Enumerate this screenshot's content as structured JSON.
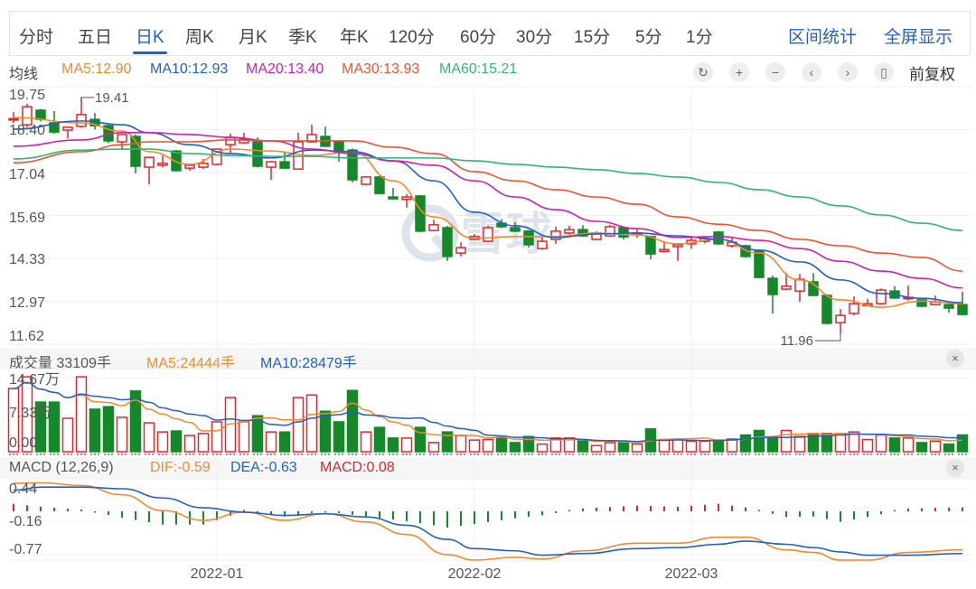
{
  "tabs": [
    "分时",
    "五日",
    "日K",
    "周K",
    "月K",
    "季K",
    "年K",
    "120分",
    "60分",
    "30分",
    "15分",
    "5分",
    "1分"
  ],
  "active_tab": "日K",
  "actions": {
    "range_stats": "区间统计",
    "fullscreen": "全屏显示"
  },
  "ma_row": {
    "title": "均线",
    "ma5": "MA5:12.90",
    "ma10": "MA10:12.93",
    "ma20": "MA20:13.40",
    "ma30": "MA30:13.93",
    "ma60": "MA60:15.21",
    "adjust": "前复权",
    "controls": [
      "reset-icon",
      "zoom-in-icon",
      "zoom-out-icon",
      "chevron-left-icon",
      "chevron-right-icon",
      "candle-style-icon"
    ]
  },
  "volume_head": {
    "title": "成交量 33109手",
    "ma5": "MA5:24444手",
    "ma10": "MA10:28479手",
    "close": "×"
  },
  "macd_head": {
    "title": "MACD (12,26,9)",
    "dif": "DIF:-0.59",
    "dea": "DEA:-0.63",
    "macd": "MACD:0.08",
    "close": "×"
  },
  "watermark": "雪球",
  "colors": {
    "up": "#e3262b",
    "down": "#15892a",
    "ma5": "#f5892a",
    "ma10": "#2360c4",
    "ma20": "#d01db5",
    "ma30": "#f4512c",
    "ma60": "#2fb874",
    "accent": "#1f5fcc"
  },
  "chart_data": [
    {
      "type": "candlestick",
      "title": "日K",
      "ylim": [
        11.62,
        19.75
      ],
      "y_ticks": [
        "19.75",
        "18.40",
        "17.04",
        "15.69",
        "14.33",
        "12.97",
        "11.62"
      ],
      "x_ticks": [
        {
          "label": "2022-01",
          "index": 15
        },
        {
          "label": "2022-02",
          "index": 34
        },
        {
          "label": "2022-03",
          "index": 50
        }
      ],
      "annotations": [
        {
          "label": "19.41",
          "index": 5,
          "kind": "high"
        },
        {
          "label": "11.96",
          "index": 61,
          "kind": "low"
        }
      ],
      "ohlc": [
        [
          18.7,
          18.95,
          18.6,
          18.74
        ],
        [
          18.55,
          19.21,
          18.47,
          19.12
        ],
        [
          19.01,
          19.05,
          18.65,
          18.72
        ],
        [
          18.61,
          18.98,
          18.27,
          18.32
        ],
        [
          18.38,
          18.5,
          18.12,
          18.47
        ],
        [
          18.5,
          19.41,
          18.45,
          18.87
        ],
        [
          18.72,
          18.92,
          18.4,
          18.52
        ],
        [
          18.52,
          18.58,
          17.97,
          18.04
        ],
        [
          18.01,
          18.26,
          17.75,
          18.24
        ],
        [
          18.18,
          18.24,
          17.01,
          17.24
        ],
        [
          17.21,
          17.52,
          16.67,
          17.52
        ],
        [
          17.27,
          17.58,
          17.2,
          17.33
        ],
        [
          17.72,
          17.75,
          17.07,
          17.1
        ],
        [
          17.18,
          17.3,
          17.1,
          17.27
        ],
        [
          17.21,
          17.47,
          17.15,
          17.33
        ],
        [
          17.3,
          17.8,
          17.27,
          17.78
        ],
        [
          17.92,
          18.27,
          17.64,
          18.15
        ],
        [
          17.98,
          18.3,
          17.95,
          18.1
        ],
        [
          18.01,
          18.15,
          17.2,
          17.24
        ],
        [
          17.21,
          17.4,
          16.81,
          17.38
        ],
        [
          17.38,
          17.69,
          17.15,
          17.18
        ],
        [
          17.15,
          18.3,
          17.15,
          18.01
        ],
        [
          18.01,
          18.55,
          17.98,
          18.24
        ],
        [
          18.18,
          18.49,
          17.85,
          17.87
        ],
        [
          18.01,
          18.04,
          17.38,
          17.72
        ],
        [
          17.75,
          17.8,
          16.73,
          16.81
        ],
        [
          16.67,
          16.93,
          16.64,
          16.9
        ],
        [
          16.9,
          16.93,
          16.35,
          16.38
        ],
        [
          16.27,
          16.56,
          16.19,
          16.21
        ],
        [
          16.19,
          16.36,
          15.93,
          16.27
        ],
        [
          16.3,
          16.33,
          15.16,
          15.19
        ],
        [
          15.21,
          15.55,
          15.18,
          15.39
        ],
        [
          15.3,
          15.36,
          14.25,
          14.39
        ],
        [
          14.5,
          14.84,
          14.39,
          14.67
        ],
        [
          14.93,
          15.1,
          14.9,
          15.02
        ],
        [
          14.87,
          15.36,
          14.84,
          15.3
        ],
        [
          15.44,
          15.56,
          15.3,
          15.33
        ],
        [
          15.3,
          15.47,
          15.16,
          15.19
        ],
        [
          15.19,
          15.22,
          14.67,
          14.76
        ],
        [
          14.64,
          14.99,
          14.6,
          14.87
        ],
        [
          14.93,
          15.33,
          14.79,
          15.19
        ],
        [
          15.13,
          15.36,
          15.08,
          15.24
        ],
        [
          15.24,
          15.38,
          15.0,
          15.04
        ],
        [
          14.93,
          15.19,
          14.9,
          15.13
        ],
        [
          15.04,
          15.39,
          15.0,
          15.33
        ],
        [
          15.3,
          15.33,
          14.93,
          15.01
        ],
        [
          15.1,
          15.25,
          14.98,
          15.13
        ],
        [
          15.02,
          15.05,
          14.3,
          14.47
        ],
        [
          14.55,
          14.84,
          14.52,
          14.61
        ],
        [
          14.7,
          14.79,
          14.25,
          14.76
        ],
        [
          14.79,
          14.99,
          14.64,
          14.9
        ],
        [
          14.87,
          15.04,
          14.8,
          14.96
        ],
        [
          15.16,
          15.2,
          14.76,
          14.79
        ],
        [
          14.73,
          15.02,
          14.67,
          14.84
        ],
        [
          14.73,
          14.76,
          14.36,
          14.39
        ],
        [
          14.56,
          14.6,
          13.7,
          13.73
        ],
        [
          13.7,
          13.79,
          12.59,
          13.19
        ],
        [
          13.36,
          13.87,
          13.33,
          13.45
        ],
        [
          13.3,
          13.84,
          12.96,
          13.67
        ],
        [
          13.59,
          13.87,
          13.13,
          13.16
        ],
        [
          13.16,
          13.2,
          12.25,
          12.28
        ],
        [
          12.3,
          12.73,
          11.96,
          12.53
        ],
        [
          12.59,
          13.13,
          12.53,
          12.9
        ],
        [
          12.84,
          13.05,
          12.82,
          12.9
        ],
        [
          12.9,
          13.38,
          12.87,
          13.33
        ],
        [
          13.3,
          13.45,
          13.05,
          13.08
        ],
        [
          13.07,
          13.47,
          13.0,
          13.1
        ],
        [
          13.02,
          13.05,
          12.79,
          12.82
        ],
        [
          12.87,
          13.16,
          12.84,
          12.96
        ],
        [
          12.87,
          12.9,
          12.62,
          12.76
        ],
        [
          12.87,
          13.28,
          12.53,
          12.56
        ]
      ],
      "ma_index": [
        0,
        5,
        8,
        10,
        13,
        16,
        19,
        22,
        25,
        28,
        31,
        34,
        37,
        40,
        43,
        46,
        49,
        52,
        55,
        58,
        61,
        64,
        67,
        70
      ],
      "series": [
        {
          "name": "MA5",
          "values": [
            18.78,
            18.61,
            18.35,
            17.7,
            17.3,
            17.78,
            17.72,
            17.58,
            17.7,
            16.78,
            15.64,
            14.96,
            15.02,
            15.02,
            15.13,
            15.07,
            14.79,
            14.93,
            14.5,
            13.65,
            13.02,
            12.79,
            12.98,
            12.9
          ]
        },
        {
          "name": "MA10",
          "values": [
            18.41,
            18.67,
            18.55,
            18.3,
            17.92,
            17.64,
            17.5,
            17.75,
            17.7,
            17.41,
            16.78,
            15.79,
            15.36,
            14.99,
            15.1,
            15.13,
            15.04,
            14.93,
            14.59,
            14.22,
            13.65,
            13.22,
            13.07,
            12.93
          ]
        },
        {
          "name": "MA20",
          "values": [
            17.87,
            18.07,
            18.3,
            18.3,
            18.24,
            18.15,
            18.04,
            17.78,
            17.64,
            17.41,
            17.27,
            16.78,
            16.27,
            15.87,
            15.5,
            15.27,
            14.99,
            15.02,
            14.9,
            14.64,
            14.24,
            13.93,
            13.7,
            13.4
          ]
        },
        {
          "name": "MA30",
          "values": [
            17.35,
            17.7,
            17.92,
            18.01,
            18.01,
            18.07,
            18.04,
            18.04,
            18.04,
            17.84,
            17.64,
            17.07,
            16.78,
            16.5,
            16.27,
            16.04,
            15.64,
            15.41,
            15.21,
            14.93,
            14.73,
            14.5,
            14.36,
            13.93
          ]
        },
        {
          "name": "MA60",
          "values": [
            17.47,
            17.75,
            17.78,
            17.78,
            17.64,
            17.58,
            17.55,
            17.55,
            17.5,
            17.5,
            17.5,
            17.41,
            17.3,
            17.21,
            17.13,
            17.01,
            16.9,
            16.73,
            16.5,
            16.27,
            15.99,
            15.7,
            15.44,
            15.21
          ]
        }
      ]
    },
    {
      "type": "bar",
      "title": "成交量",
      "unit": "万手",
      "y_ticks": [
        "14.67万",
        "7.33万",
        "0.00"
      ],
      "ylim": [
        0,
        14.67
      ],
      "values": [
        12.5,
        14.8,
        9.8,
        9.8,
        6.6,
        14.8,
        8.4,
        8.9,
        6.8,
        12.0,
        5.7,
        3.9,
        4.1,
        3.2,
        3.6,
        5.9,
        10.7,
        5.9,
        7.1,
        3.9,
        3.9,
        10.7,
        11.2,
        8.0,
        5.9,
        12.1,
        3.9,
        4.8,
        2.7,
        2.7,
        4.8,
        1.8,
        3.9,
        3.2,
        2.3,
        2.4,
        2.7,
        1.8,
        3.0,
        1.5,
        2.7,
        2.7,
        2.1,
        1.2,
        1.8,
        1.9,
        1.5,
        4.5,
        2.4,
        2.4,
        2.1,
        2.1,
        2.3,
        2.5,
        3.3,
        4.2,
        2.7,
        4.2,
        3.0,
        3.6,
        3.6,
        3.6,
        3.9,
        2.4,
        3.3,
        2.7,
        2.7,
        1.8,
        2.1,
        1.5,
        3.31
      ]
    },
    {
      "type": "line",
      "title": "MACD (12,26,9)",
      "y_ticks": [
        "0.44",
        "-0.16",
        "-0.77"
      ],
      "ylim": [
        -0.77,
        0.44
      ],
      "index": [
        0,
        2,
        5,
        8,
        11,
        14,
        17,
        20,
        23,
        26,
        29,
        32,
        34,
        37,
        39,
        42,
        46,
        49,
        52,
        54,
        57,
        59,
        61,
        63,
        66,
        70
      ],
      "series": [
        {
          "name": "DIF",
          "values": [
            0.54,
            0.55,
            0.5,
            0.33,
            0.04,
            -0.14,
            0.01,
            -0.14,
            -0.02,
            -0.17,
            -0.4,
            -0.77,
            -0.88,
            -0.82,
            -0.85,
            -0.7,
            -0.56,
            -0.56,
            -0.45,
            -0.45,
            -0.68,
            -0.73,
            -0.9,
            -0.88,
            -0.73,
            -0.68
          ]
        },
        {
          "name": "DEA",
          "values": [
            0.41,
            0.47,
            0.47,
            0.44,
            0.27,
            0.09,
            0.01,
            -0.05,
            -0.02,
            -0.08,
            -0.23,
            -0.49,
            -0.66,
            -0.7,
            -0.78,
            -0.75,
            -0.66,
            -0.64,
            -0.58,
            -0.52,
            -0.58,
            -0.64,
            -0.72,
            -0.78,
            -0.78,
            -0.75
          ]
        }
      ]
    }
  ]
}
